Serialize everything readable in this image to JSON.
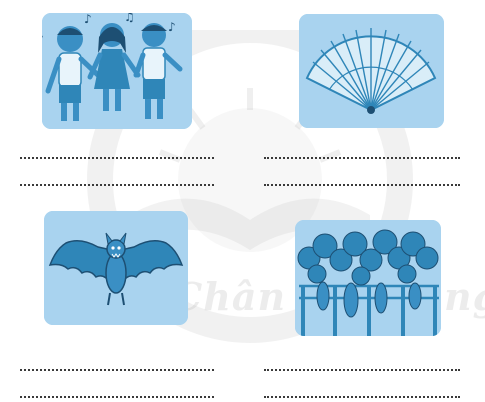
{
  "watermark": {
    "text": "Chân trời sáng tạo"
  },
  "exercise": {
    "pictures": [
      {
        "subject": "children-singing-icon"
      },
      {
        "subject": "hand-fan-icon"
      },
      {
        "subject": "bat-icon"
      },
      {
        "subject": "gourd-trellis-icon"
      }
    ],
    "answer_lines_per_picture": 2
  },
  "colors": {
    "card_background": "#a9d3ef",
    "illustration": "#2f86b8",
    "dotted_line": "#3a3a3a"
  }
}
